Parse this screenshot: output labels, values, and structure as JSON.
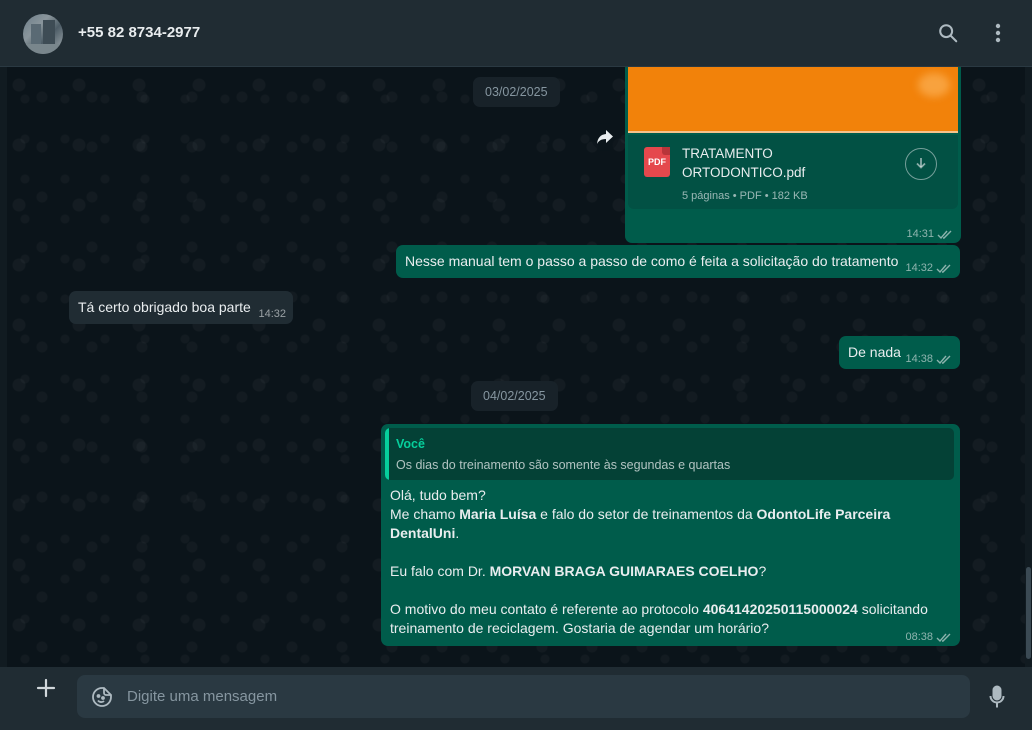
{
  "header": {
    "contact_name": "+55 82 8734-2977",
    "icons": {
      "search": "search-icon",
      "menu": "kebab-menu-icon",
      "avatar": "contact-avatar"
    }
  },
  "dates": {
    "first": "03/02/2025",
    "second": "04/02/2025"
  },
  "messages": {
    "pdf": {
      "file_name": "TRATAMENTO ORTODONTICO.pdf",
      "icon_label": "PDF",
      "info": "5 páginas • PDF • 182 KB",
      "time": "14:31"
    },
    "manual": {
      "text": "Nesse manual tem o passo a passo de como é feita a solicitação do tratamento",
      "time": "14:32"
    },
    "incoming": {
      "text": "Tá certo obrigado boa parte",
      "time": "14:32"
    },
    "denada": {
      "text": "De nada",
      "time": "14:38"
    },
    "long": {
      "reply_author": "Você",
      "reply_text": "Os dias do treinamento são somente às segundas e quartas",
      "line1": "Olá, tudo bem?",
      "line2_a": "Me chamo ",
      "line2_b": "Maria Luísa",
      "line2_c": " e falo do setor de treinamentos da ",
      "line2_d": "OdontoLife Parceira DentalUni",
      "line2_e": ".",
      "line3_a": "Eu falo com Dr. ",
      "line3_b": "MORVAN BRAGA GUIMARAES COELHO",
      "line3_c": "?",
      "line4_a": "O motivo do meu contato é referente ao protocolo ",
      "line4_b": "40641420250115000024",
      "line4_c": " solicitando treinamento de reciclagem. Gostaria de agendar um horário?",
      "time": "08:38"
    }
  },
  "composer": {
    "placeholder": "Digite uma mensagem",
    "value": ""
  },
  "colors": {
    "outgoing_bubble": "#005c4b",
    "incoming_bubble": "#202c33",
    "header": "#202c33",
    "accent": "#06cf9c",
    "pdf_red": "#e5484d"
  }
}
